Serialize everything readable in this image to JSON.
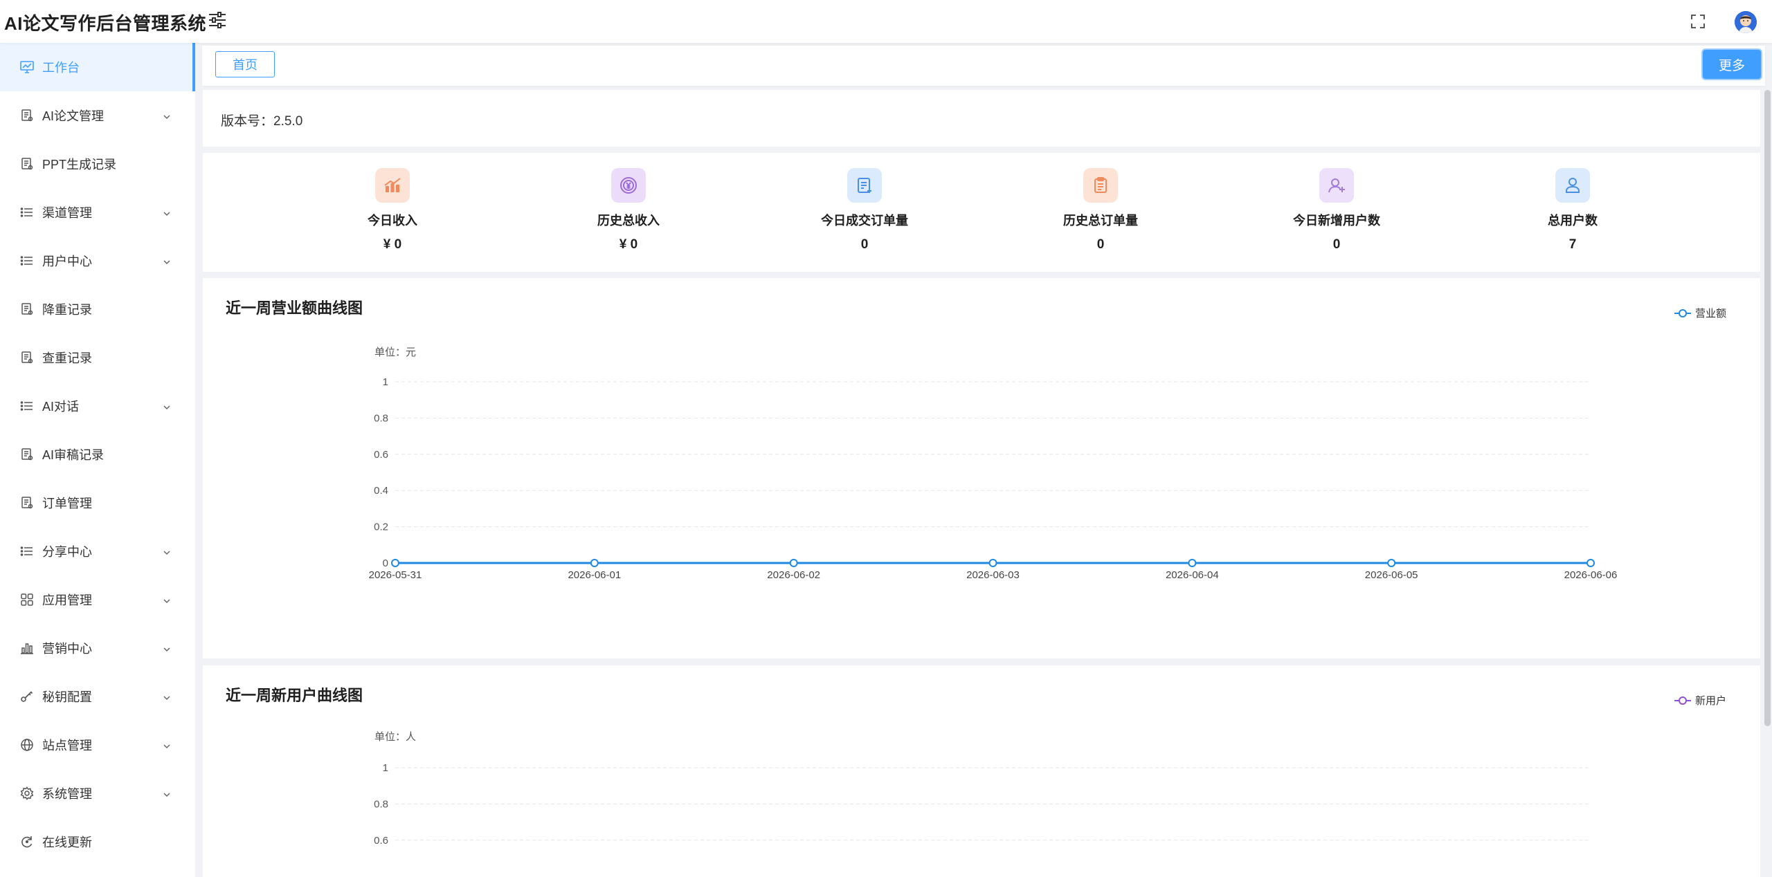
{
  "app": {
    "title": "AI论文写作后台管理系统"
  },
  "sidebar": {
    "items": [
      {
        "label": "工作台",
        "icon": "workbench-icon",
        "active": true,
        "expandable": false
      },
      {
        "label": "AI论文管理",
        "icon": "document-icon",
        "expandable": true
      },
      {
        "label": "PPT生成记录",
        "icon": "document-icon",
        "expandable": false
      },
      {
        "label": "渠道管理",
        "icon": "list-icon",
        "expandable": true
      },
      {
        "label": "用户中心",
        "icon": "list-icon",
        "expandable": true
      },
      {
        "label": "降重记录",
        "icon": "document-icon",
        "expandable": false
      },
      {
        "label": "查重记录",
        "icon": "document-icon",
        "expandable": false
      },
      {
        "label": "AI对话",
        "icon": "list-icon",
        "expandable": true
      },
      {
        "label": "AI审稿记录",
        "icon": "document-icon",
        "expandable": false
      },
      {
        "label": "订单管理",
        "icon": "document-icon",
        "expandable": false
      },
      {
        "label": "分享中心",
        "icon": "list-icon",
        "expandable": true
      },
      {
        "label": "应用管理",
        "icon": "grid-icon",
        "expandable": true
      },
      {
        "label": "营销中心",
        "icon": "bar-chart-icon",
        "expandable": true
      },
      {
        "label": "秘钥配置",
        "icon": "key-icon",
        "expandable": true
      },
      {
        "label": "站点管理",
        "icon": "globe-icon",
        "expandable": true
      },
      {
        "label": "系统管理",
        "icon": "gear-icon",
        "expandable": true
      },
      {
        "label": "在线更新",
        "icon": "refresh-icon",
        "expandable": false
      }
    ]
  },
  "tags": {
    "home": "首页",
    "more": "更多"
  },
  "version": {
    "text": "版本号：2.5.0"
  },
  "stats": [
    {
      "title": "今日收入",
      "value": "¥ 0",
      "icon": "income-icon",
      "color": "#f08a5d",
      "bg": "#fde3d6"
    },
    {
      "title": "历史总收入",
      "value": "¥ 0",
      "icon": "yuan-coin-icon",
      "color": "#9b6ad8",
      "bg": "#ebdcfa"
    },
    {
      "title": "今日成交订单量",
      "value": "0",
      "icon": "order-icon",
      "color": "#4a90e2",
      "bg": "#dbeafc"
    },
    {
      "title": "历史总订单量",
      "value": "0",
      "icon": "clipboard-icon",
      "color": "#f08a5d",
      "bg": "#fde3d6"
    },
    {
      "title": "今日新增用户数",
      "value": "0",
      "icon": "add-user-icon",
      "color": "#a27ad8",
      "bg": "#ece0fa"
    },
    {
      "title": "总用户数",
      "value": "7",
      "icon": "user-icon",
      "color": "#4a90e2",
      "bg": "#dbeafc"
    }
  ],
  "chart_data": [
    {
      "type": "line",
      "title": "近一周营业额曲线图",
      "unit_label": "单位：元",
      "x": [
        "2026-05-31",
        "2026-06-01",
        "2026-06-02",
        "2026-06-03",
        "2026-06-04",
        "2026-06-05",
        "2026-06-06"
      ],
      "series": [
        {
          "name": "营业额",
          "values": [
            0,
            0,
            0,
            0,
            0,
            0,
            0
          ],
          "color": "#1e88e5"
        }
      ],
      "yticks": [
        "1",
        "0.8",
        "0.6",
        "0.4",
        "0.2",
        "0"
      ],
      "ylim": [
        0,
        1
      ],
      "grid": true,
      "legend": "top-right"
    },
    {
      "type": "line",
      "title": "近一周新用户曲线图",
      "unit_label": "单位：人",
      "x": [],
      "series": [
        {
          "name": "新用户",
          "values": [],
          "color": "#8e4fd6"
        }
      ],
      "yticks": [
        "1",
        "0.8",
        "0.6"
      ],
      "ylim": [
        0,
        1
      ],
      "grid": true,
      "legend": "top-right"
    }
  ]
}
